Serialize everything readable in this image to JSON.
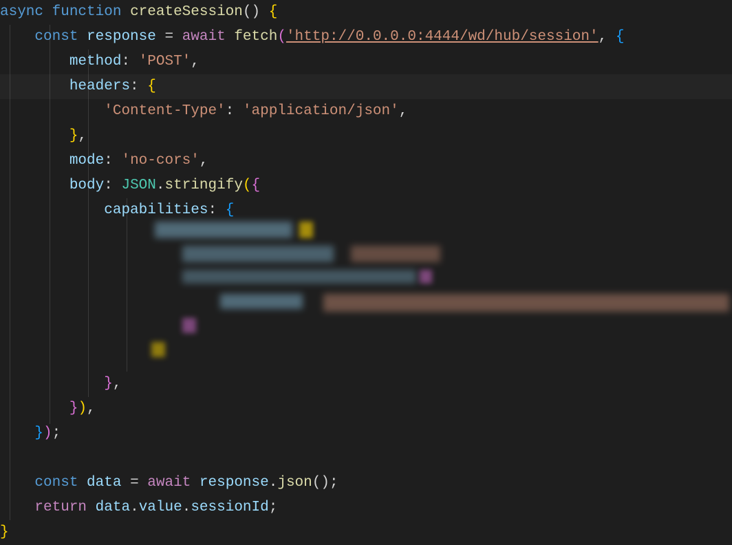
{
  "code": {
    "l1": {
      "async": "async",
      "function": "function",
      "name": "createSession",
      "parens": "()",
      "brace": " {"
    },
    "l2": {
      "const": "const",
      "varname": "response",
      "eq": " = ",
      "await": "await",
      "fetch": "fetch",
      "paren_open": "(",
      "url": "'http://0.0.0.0:4444/wd/hub/session'",
      "comma_brace": ", {"
    },
    "l3": {
      "key": "method",
      "colon": ": ",
      "val": "'POST'",
      "comma": ","
    },
    "l4": {
      "key": "headers",
      "colon": ": ",
      "brace": "{"
    },
    "l5": {
      "key": "'Content-Type'",
      "colon": ": ",
      "val": "'application/json'",
      "comma": ","
    },
    "l6": {
      "brace": "},"
    },
    "l7": {
      "key": "mode",
      "colon": ": ",
      "val": "'no-cors'",
      "comma": ","
    },
    "l8": {
      "key": "body",
      "colon": ": ",
      "json": "JSON",
      "dot": ".",
      "stringify": "stringify",
      "paren_brace": "({"
    },
    "l9": {
      "key": "capabilities",
      "colon": ": ",
      "brace": "{"
    },
    "l15": {
      "brace": "},"
    },
    "l16": {
      "brace_paren": "}),"
    },
    "l17": {
      "brace_paren": "});"
    },
    "l19": {
      "const": "const",
      "varname": "data",
      "eq": " = ",
      "await": "await",
      "response": "response",
      "dot": ".",
      "json": "json",
      "parens": "();"
    },
    "l20": {
      "return": "return",
      "data": "data",
      "dot1": ".",
      "value": "value",
      "dot2": ".",
      "sessionId": "sessionId",
      "semi": ";"
    },
    "l21": {
      "brace": "}"
    }
  }
}
